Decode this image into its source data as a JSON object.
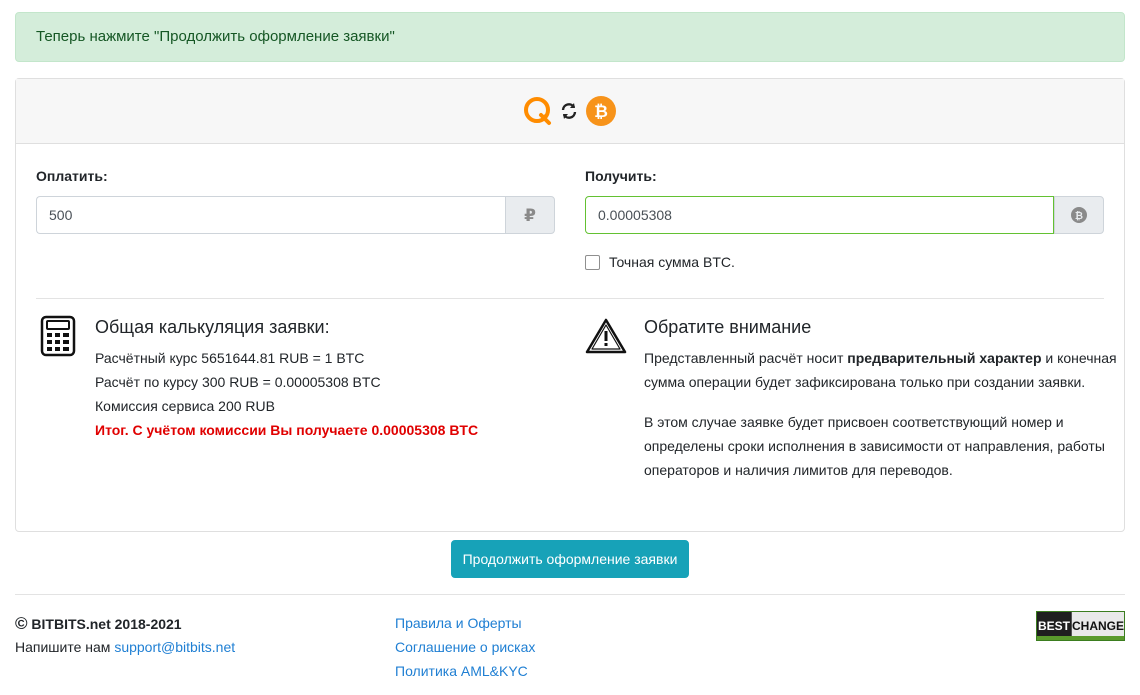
{
  "alert": {
    "text": "Теперь нажмите \"Продолжить оформление заявки\""
  },
  "header": {
    "from_icon": "qiwi-icon",
    "swap_icon": "refresh-icon",
    "to_icon": "bitcoin-icon"
  },
  "pay": {
    "label": "Оплатить:",
    "value": "500",
    "currency_icon": "ruble-icon"
  },
  "receive": {
    "label": "Получить:",
    "value": "0.00005308",
    "currency_icon": "bitcoin-icon"
  },
  "exact_amount": {
    "label": "Точная сумма BTC.",
    "checked": false
  },
  "calc": {
    "title": "Общая калькуляция заявки:",
    "rate": "Расчётный курс 5651644.81 RUB = 1 BTC",
    "calc": "Расчёт по курсу 300 RUB = 0.00005308 BTC",
    "commission": "Комиссия сервиса 200 RUB",
    "total": "Итог. С учётом комиссии Вы получаете 0.00005308 BTC"
  },
  "notice": {
    "title": "Обратите внимание",
    "p1_before": "Представленный расчёт носит ",
    "p1_bold": "предварительный характер",
    "p1_after": " и конечная",
    "p1_line2": "сумма операции будет зафиксирована только при создании заявки.",
    "p2_line1": "В этом случае заявке будет присвоен соответствующий номер и",
    "p2_line2": "определены сроки исполнения в зависимости от направления, работы",
    "p2_line3": "операторов и наличия лимитов для переводов."
  },
  "continue_button": "Продолжить оформление заявки",
  "footer": {
    "copyright_symbol": "©",
    "copyright": "BITBITS.net 2018-2021",
    "write_us": "Напишите нам ",
    "email": "support@bitbits.net",
    "links": [
      "Правила и Оферты",
      "Соглашение о рисках",
      "Политика AML&KYC"
    ],
    "badge_left": "BEST",
    "badge_right": "CHANGE"
  },
  "colors": {
    "accent": "#17a2b8",
    "success_bg": "#d4edda",
    "bitcoin": "#f7931a",
    "qiwi": "#ff8c00",
    "error": "#e00000",
    "link": "#1f7fd3"
  }
}
